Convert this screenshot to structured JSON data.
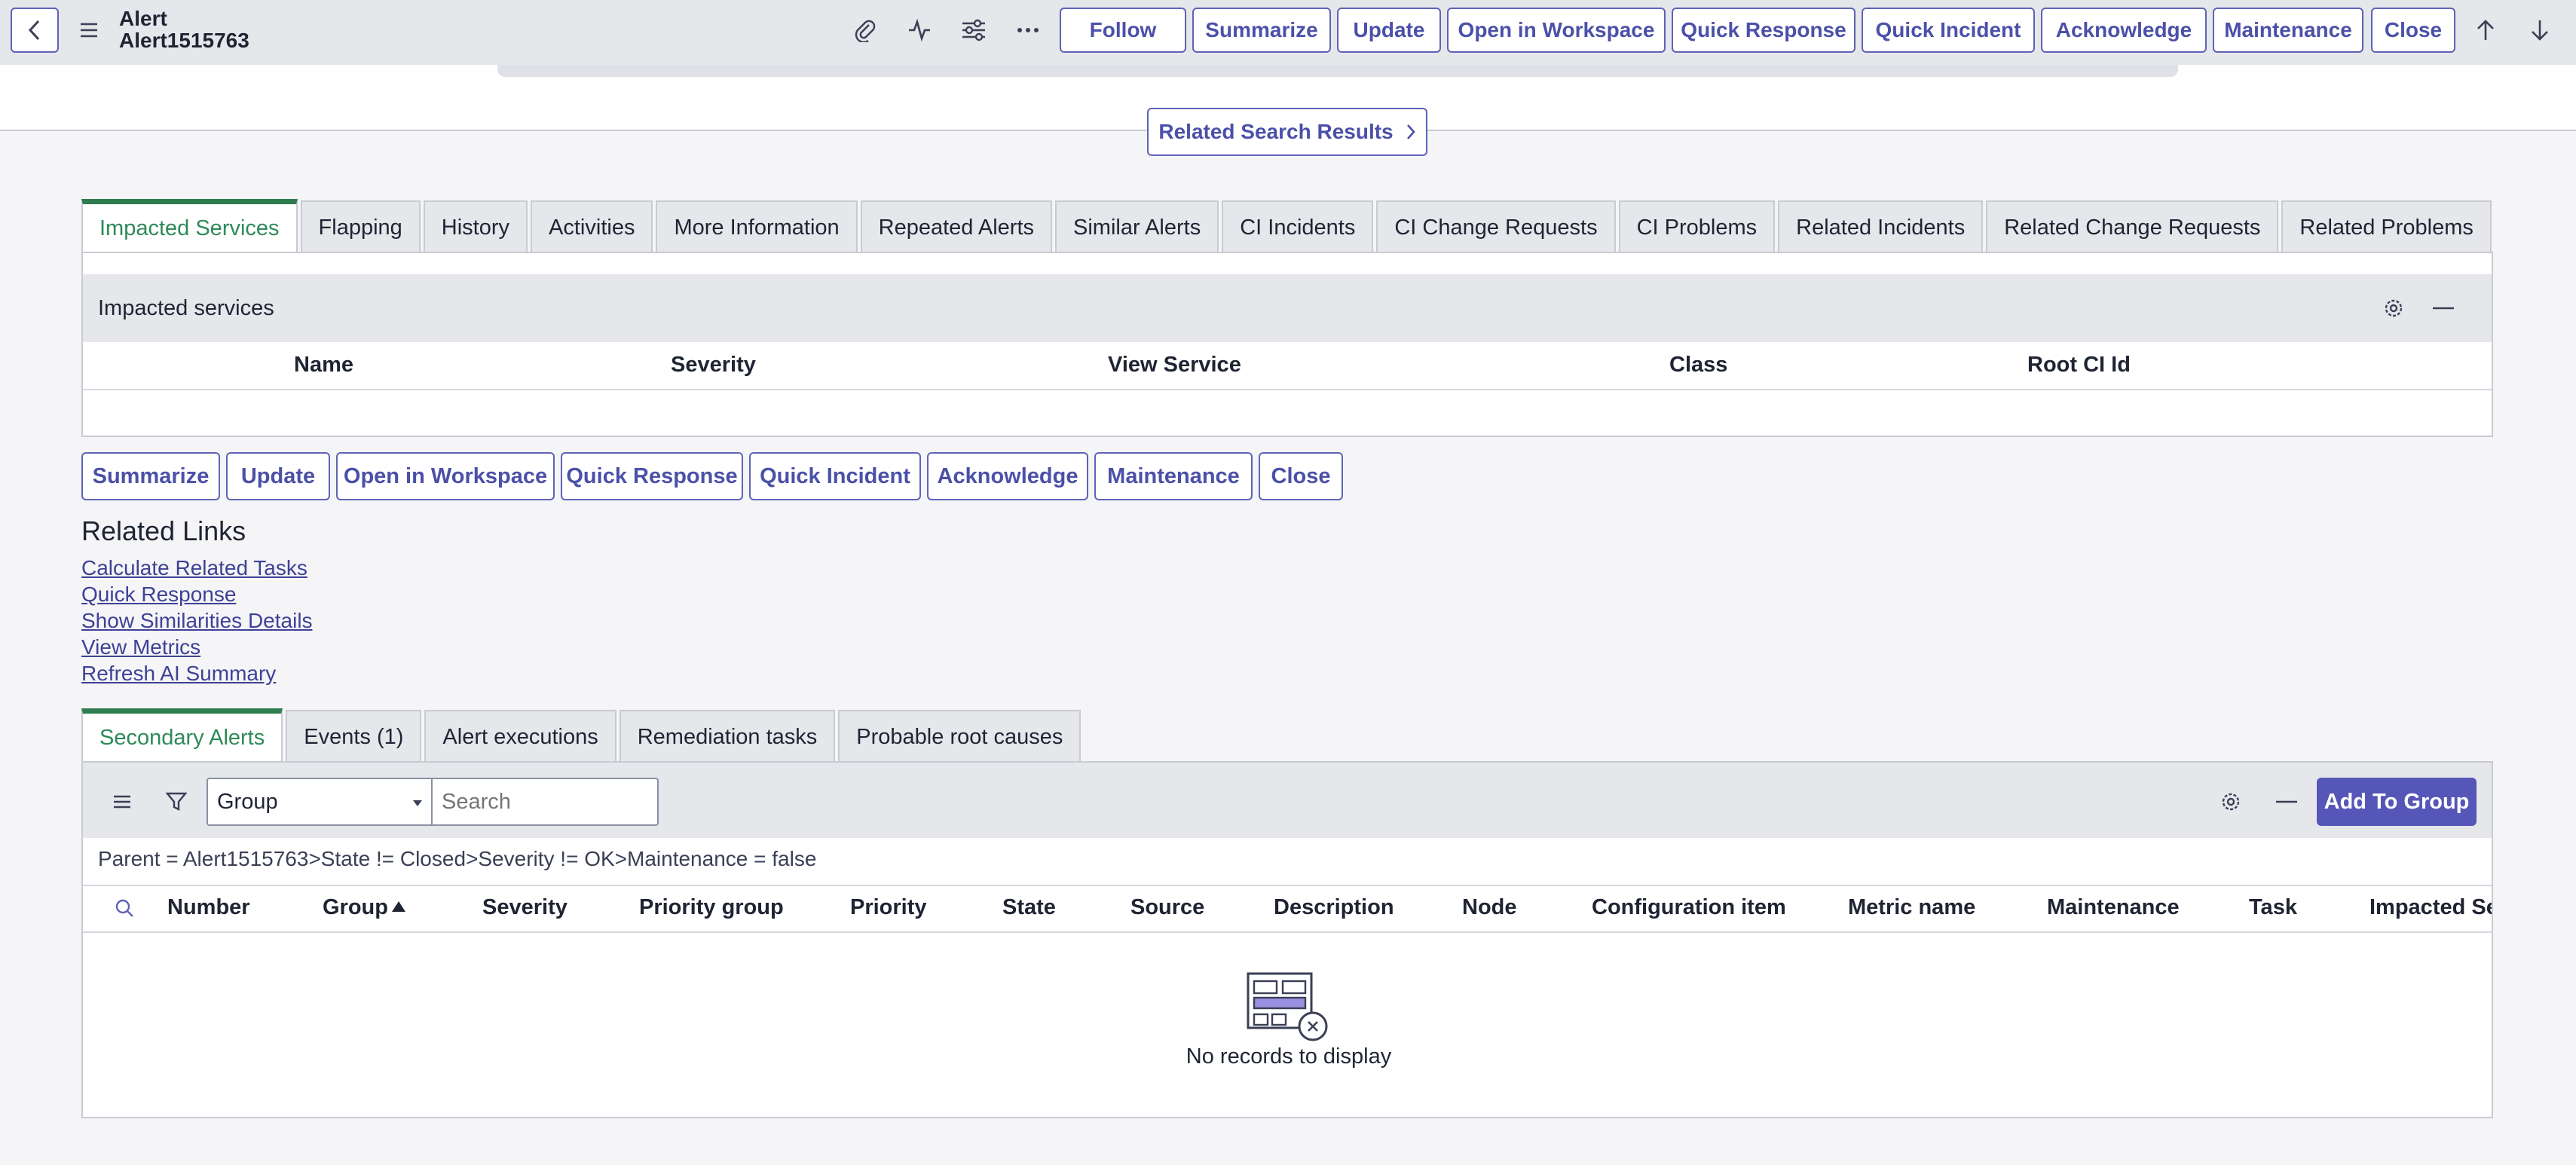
{
  "header": {
    "record_type": "Alert",
    "record_number": "Alert1515763",
    "icons": [
      "paperclip-icon",
      "activity-icon",
      "sliders-icon",
      "more-icon",
      "arrow-up-icon",
      "arrow-down-icon"
    ],
    "buttons": [
      "Follow",
      "Summarize",
      "Update",
      "Open in Workspace",
      "Quick Response",
      "Quick Incident",
      "Acknowledge",
      "Maintenance",
      "Close"
    ]
  },
  "related_search_results": "Related Search Results",
  "tabs": [
    "Impacted Services",
    "Flapping",
    "History",
    "Activities",
    "More Information",
    "Repeated Alerts",
    "Similar Alerts",
    "CI Incidents",
    "CI Change Requests",
    "CI Problems",
    "Related Incidents",
    "Related Change Requests",
    "Related Problems"
  ],
  "impacted_panel": {
    "title": "Impacted services",
    "columns": [
      "Name",
      "Severity",
      "View Service",
      "Class",
      "Root CI Id"
    ]
  },
  "actions": [
    "Summarize",
    "Update",
    "Open in Workspace",
    "Quick Response",
    "Quick Incident",
    "Acknowledge",
    "Maintenance",
    "Close"
  ],
  "related_links": {
    "title": "Related Links",
    "links": [
      "Calculate Related Tasks",
      "Quick Response",
      "Show Similarities Details",
      "View Metrics",
      "Refresh AI Summary"
    ]
  },
  "secondary_tabs": [
    "Secondary Alerts",
    "Events (1)",
    "Alert executions",
    "Remediation tasks",
    "Probable root causes"
  ],
  "secondary_list": {
    "group_select": "Group",
    "search_placeholder": "Search",
    "add_button": "Add To Group",
    "condition": "Parent = Alert1515763>State != Closed>Severity != OK>Maintenance = false",
    "columns": [
      "Number",
      "Group",
      "Severity",
      "Priority group",
      "Priority",
      "State",
      "Source",
      "Description",
      "Node",
      "Configuration item",
      "Metric name",
      "Maintenance",
      "Task",
      "Impacted Ser"
    ],
    "sort_column": "Group",
    "empty_message": "No records to display"
  },
  "colors": {
    "accent": "#5656b8",
    "active_tab": "#2e7d4f",
    "link": "#3d4296"
  }
}
